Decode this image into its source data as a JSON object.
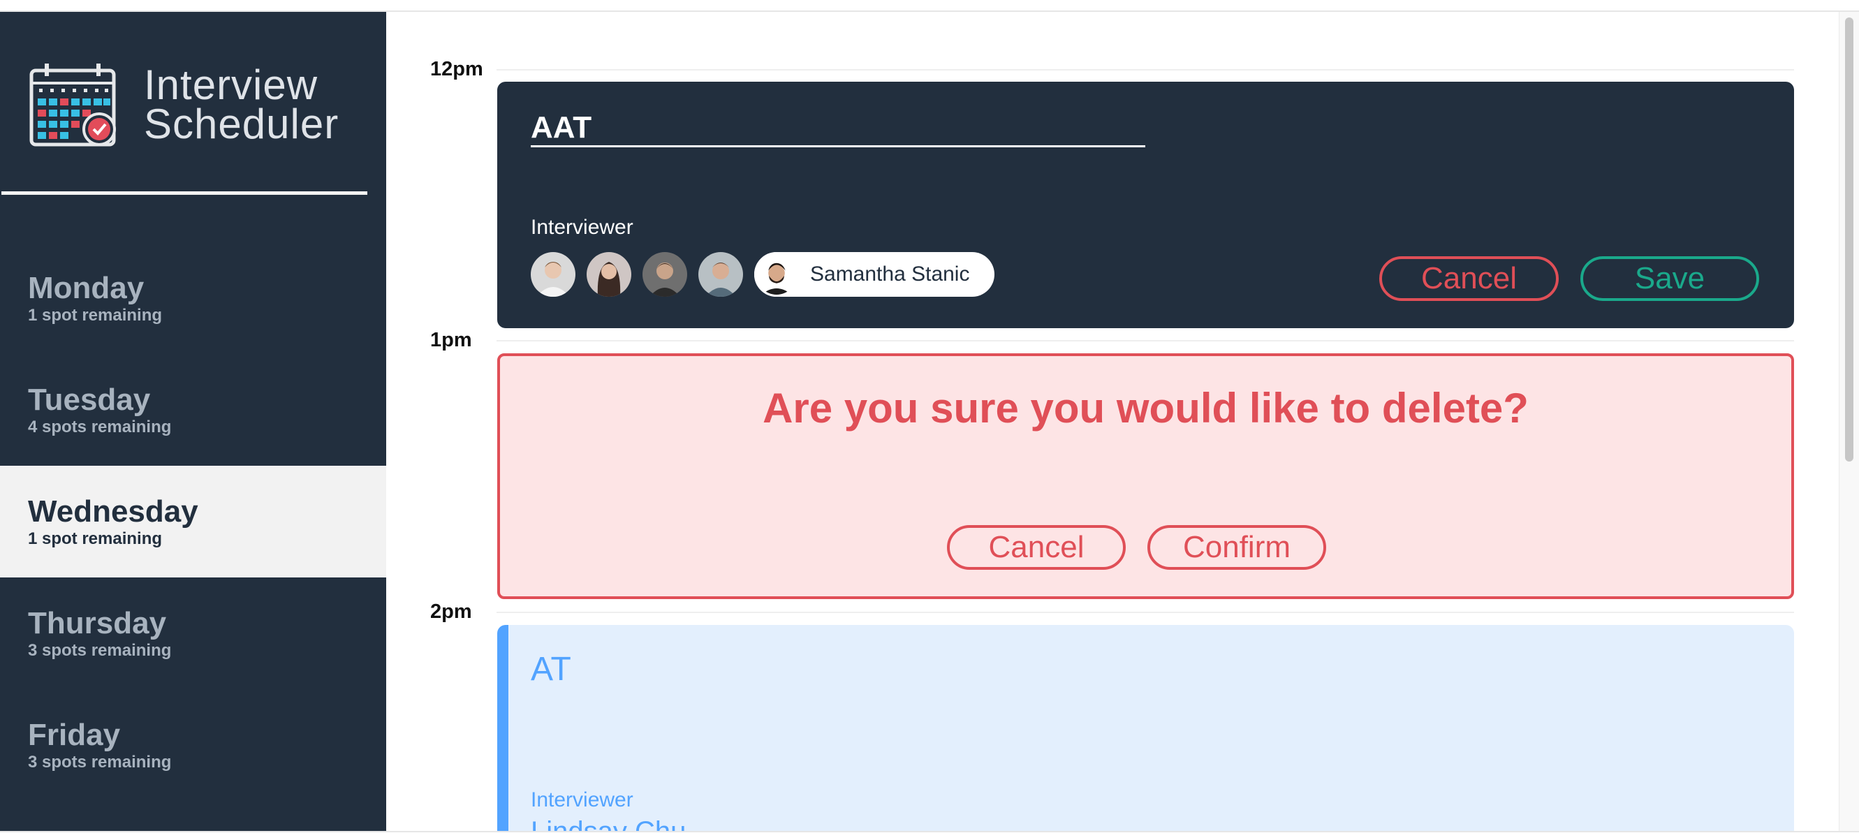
{
  "brand": {
    "line1": "Interview",
    "line2": "Scheduler"
  },
  "days": [
    {
      "name": "Monday",
      "spots": "1 spot remaining",
      "selected": false
    },
    {
      "name": "Tuesday",
      "spots": "4 spots remaining",
      "selected": false
    },
    {
      "name": "Wednesday",
      "spots": "1 spot remaining",
      "selected": true
    },
    {
      "name": "Thursday",
      "spots": "3 spots remaining",
      "selected": false
    },
    {
      "name": "Friday",
      "spots": "3 spots remaining",
      "selected": false
    }
  ],
  "schedule": {
    "times": [
      "12pm",
      "1pm",
      "2pm"
    ],
    "edit_form": {
      "student_value": "AAT",
      "interviewer_title": "Interviewer",
      "selected_interviewer": "Samantha Stanic",
      "cancel_label": "Cancel",
      "save_label": "Save"
    },
    "confirm": {
      "message": "Are you sure you would like to delete?",
      "cancel_label": "Cancel",
      "confirm_label": "Confirm"
    },
    "appointment": {
      "student": "AT",
      "interviewer_title": "Interviewer",
      "interviewer_name": "Lindsay Chu"
    }
  },
  "colors": {
    "sidebar": "#222f3e",
    "danger": "#e04f57",
    "success": "#1aa98b",
    "accent": "#52a3ff"
  }
}
